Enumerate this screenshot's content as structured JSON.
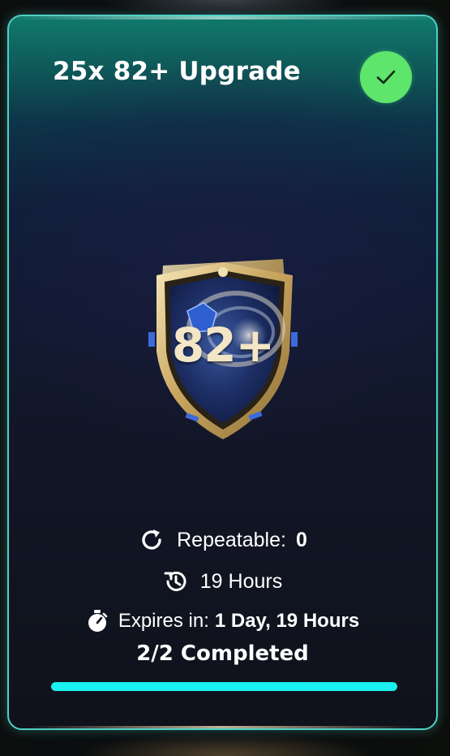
{
  "card": {
    "title": "25x 82+ Upgrade",
    "completed_icon": "check-icon",
    "pack": {
      "rating_label": "82+",
      "image": "pack-shield-image"
    },
    "repeatable": {
      "icon": "refresh-icon",
      "label": "Repeatable:",
      "value": "0"
    },
    "cooldown": {
      "icon": "history-icon",
      "text": "19 Hours"
    },
    "expiry": {
      "icon": "stopwatch-icon",
      "label": "Expires in:",
      "value": "1 Day, 19 Hours"
    },
    "completion": {
      "text": "2/2 Completed",
      "progress": 1.0
    }
  },
  "colors": {
    "accent_border": "#4fd0c6",
    "check_badge": "#5ee56b",
    "progress_fill": "#19f0ef"
  }
}
